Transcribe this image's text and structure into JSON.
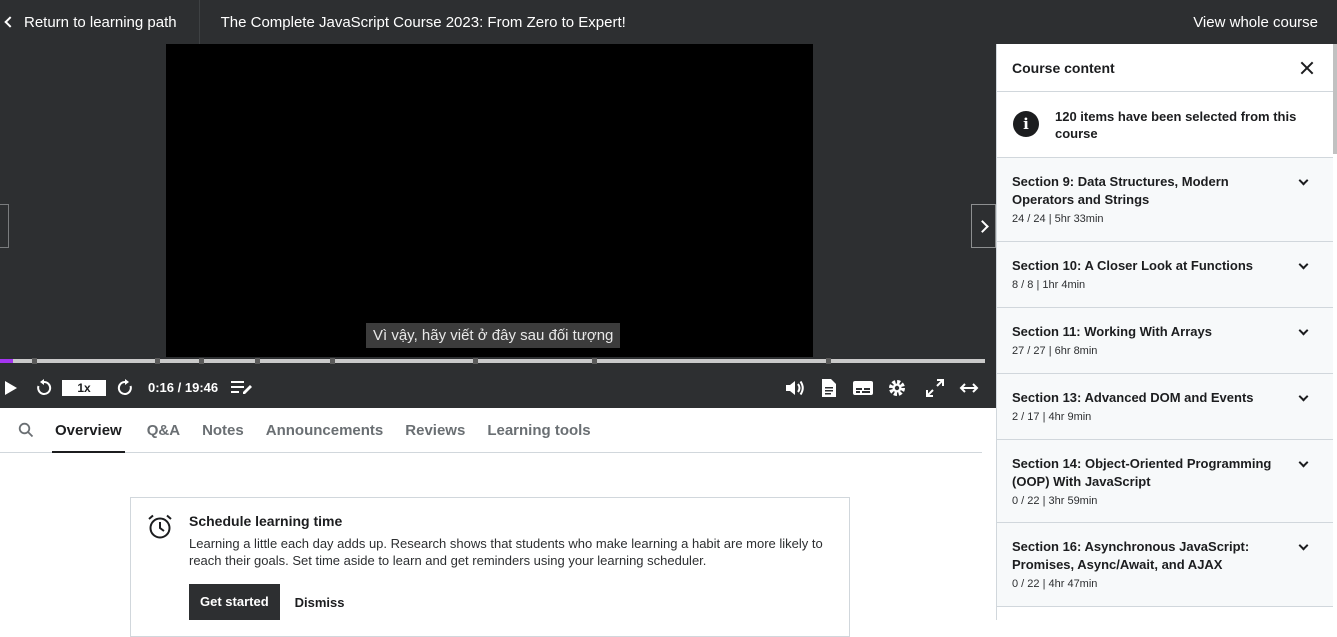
{
  "topbar": {
    "back_label": "Return to learning path",
    "course_title": "The Complete JavaScript Course 2023: From Zero to Expert!",
    "view_whole_label": "View whole course"
  },
  "player": {
    "caption": "Vì vậy, hãy viết ở đây sau đối tượng",
    "speed": "1x",
    "time": "0:16 / 19:46",
    "progress_fraction": 0.0135,
    "accent_color": "#a435f0"
  },
  "tabs": [
    {
      "label": "Overview",
      "active": true
    },
    {
      "label": "Q&A",
      "active": false
    },
    {
      "label": "Notes",
      "active": false
    },
    {
      "label": "Announcements",
      "active": false
    },
    {
      "label": "Reviews",
      "active": false
    },
    {
      "label": "Learning tools",
      "active": false
    }
  ],
  "schedule_card": {
    "title": "Schedule learning time",
    "text": "Learning a little each day adds up. Research shows that students who make learning a habit are more likely to reach their goals. Set time aside to learn and get reminders using your learning scheduler.",
    "primary_label": "Get started",
    "secondary_label": "Dismiss"
  },
  "sidebar": {
    "title": "Course content",
    "info_text": "120 items have been selected from this course",
    "sections": [
      {
        "title": "Section 9: Data Structures, Modern Operators and Strings",
        "meta": "24 / 24 | 5hr 33min"
      },
      {
        "title": "Section 10: A Closer Look at Functions",
        "meta": "8 / 8 | 1hr 4min"
      },
      {
        "title": "Section 11: Working With Arrays",
        "meta": "27 / 27 | 6hr 8min"
      },
      {
        "title": "Section 13: Advanced DOM and Events",
        "meta": "2 / 17 | 4hr 9min"
      },
      {
        "title": "Section 14: Object-Oriented Programming (OOP) With JavaScript",
        "meta": "0 / 22 | 3hr 59min"
      },
      {
        "title": "Section 16: Asynchronous JavaScript: Promises, Async/Await, and AJAX",
        "meta": "0 / 22 | 4hr 47min"
      }
    ]
  }
}
